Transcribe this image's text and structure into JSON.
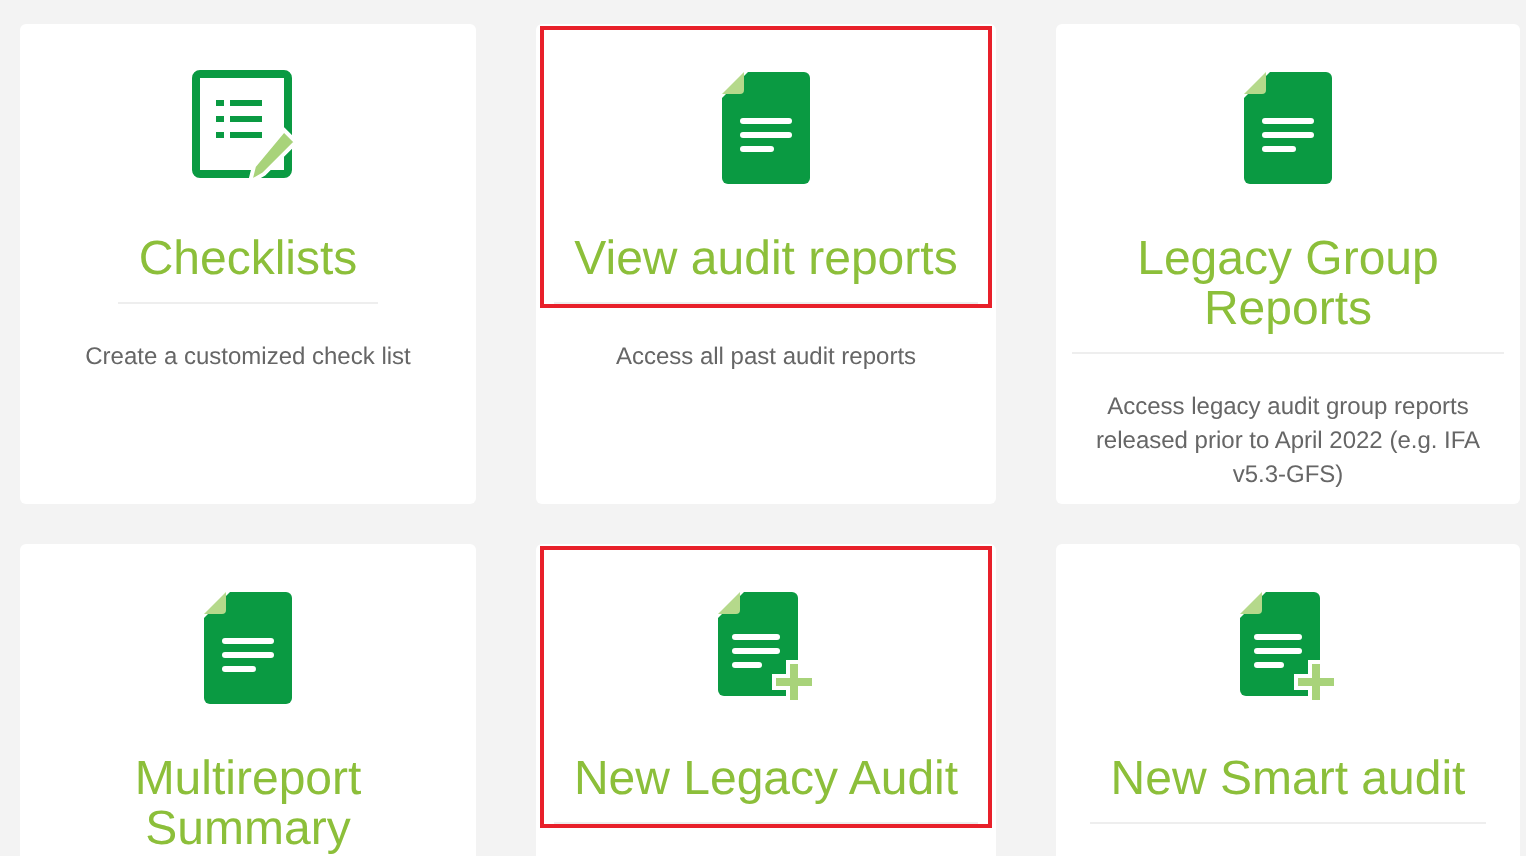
{
  "cards": [
    {
      "kind": "checklist",
      "title": "Checklists",
      "description": "Create a customized check list",
      "highlighted": false
    },
    {
      "kind": "report",
      "title": "View audit reports",
      "description": "Access all past audit reports",
      "highlighted": true
    },
    {
      "kind": "report",
      "title": "Legacy Group Reports",
      "description": "Access legacy audit group reports released prior to April 2022 (e.g. IFA v5.3-GFS)",
      "highlighted": false
    },
    {
      "kind": "report",
      "title": "Multireport Summary",
      "highlighted": false
    },
    {
      "kind": "new",
      "title": "New Legacy Audit",
      "highlighted": true
    },
    {
      "kind": "new",
      "title": "New Smart audit",
      "highlighted": false
    }
  ]
}
